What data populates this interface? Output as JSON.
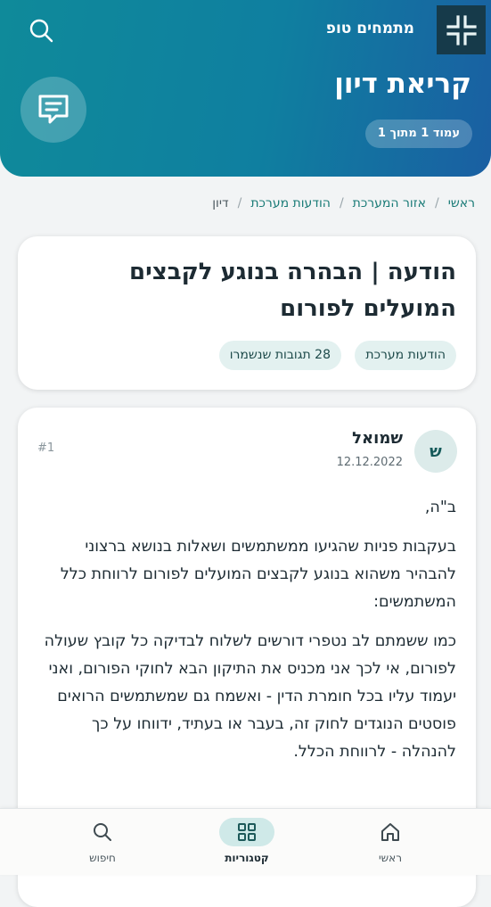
{
  "header": {
    "brand": "מתמחים טופ",
    "page_title": "קריאת דיון",
    "page_indicator": "עמוד 1 מתוך 1",
    "icons": {
      "logo": "compress-arrows-icon",
      "search": "search-icon",
      "comment": "comment-icon"
    }
  },
  "breadcrumb": {
    "items": [
      "ראשי",
      "אזור המערכת",
      "הודעות מערכת",
      "דיון"
    ]
  },
  "topic": {
    "title": "הודעה | הבהרה בנוגע לקבצים המועלים לפורום",
    "tags": [
      "הודעות מערכת",
      "28 תגובות שנשמרו"
    ]
  },
  "post": {
    "avatar_letter": "ש",
    "author": "שמואל",
    "date": "12.12.2022",
    "number": "#1",
    "paragraphs": [
      "ב\"ה,",
      "בעקבות פניות שהגיעו ממשתמשים ושאלות בנושא ברצוני להבהיר משהוא בנוגע לקבצים המועלים לפורום לרווחת כלל המשתמשים:",
      "כמו ששמתם לב נטפרי דורשים לשלוח לבדיקה כל קובץ שעולה לפורום, אי לכך אני מכניס את התיקון הבא לחוקי הפורום, ואני יעמוד עליו בכל חומרת הדין - ואשמח גם שמשתמשים הרואים פוסטים הנוגדים לחוק זה, בעבר או בעתיד, ידווחו על כך להנהלה - לרווחת הכלל."
    ]
  },
  "bottom_nav": {
    "items": [
      {
        "label": "ראשי",
        "icon": "home-icon"
      },
      {
        "label": "קטגוריות",
        "icon": "grid-icon",
        "active": true
      },
      {
        "label": "חיפוש",
        "icon": "search-icon"
      }
    ]
  },
  "colors": {
    "hero_start": "#0f8a9a",
    "hero_end": "#1a5fa2",
    "accent": "#1a7b77",
    "chip_bg": "#e3f1f0"
  }
}
